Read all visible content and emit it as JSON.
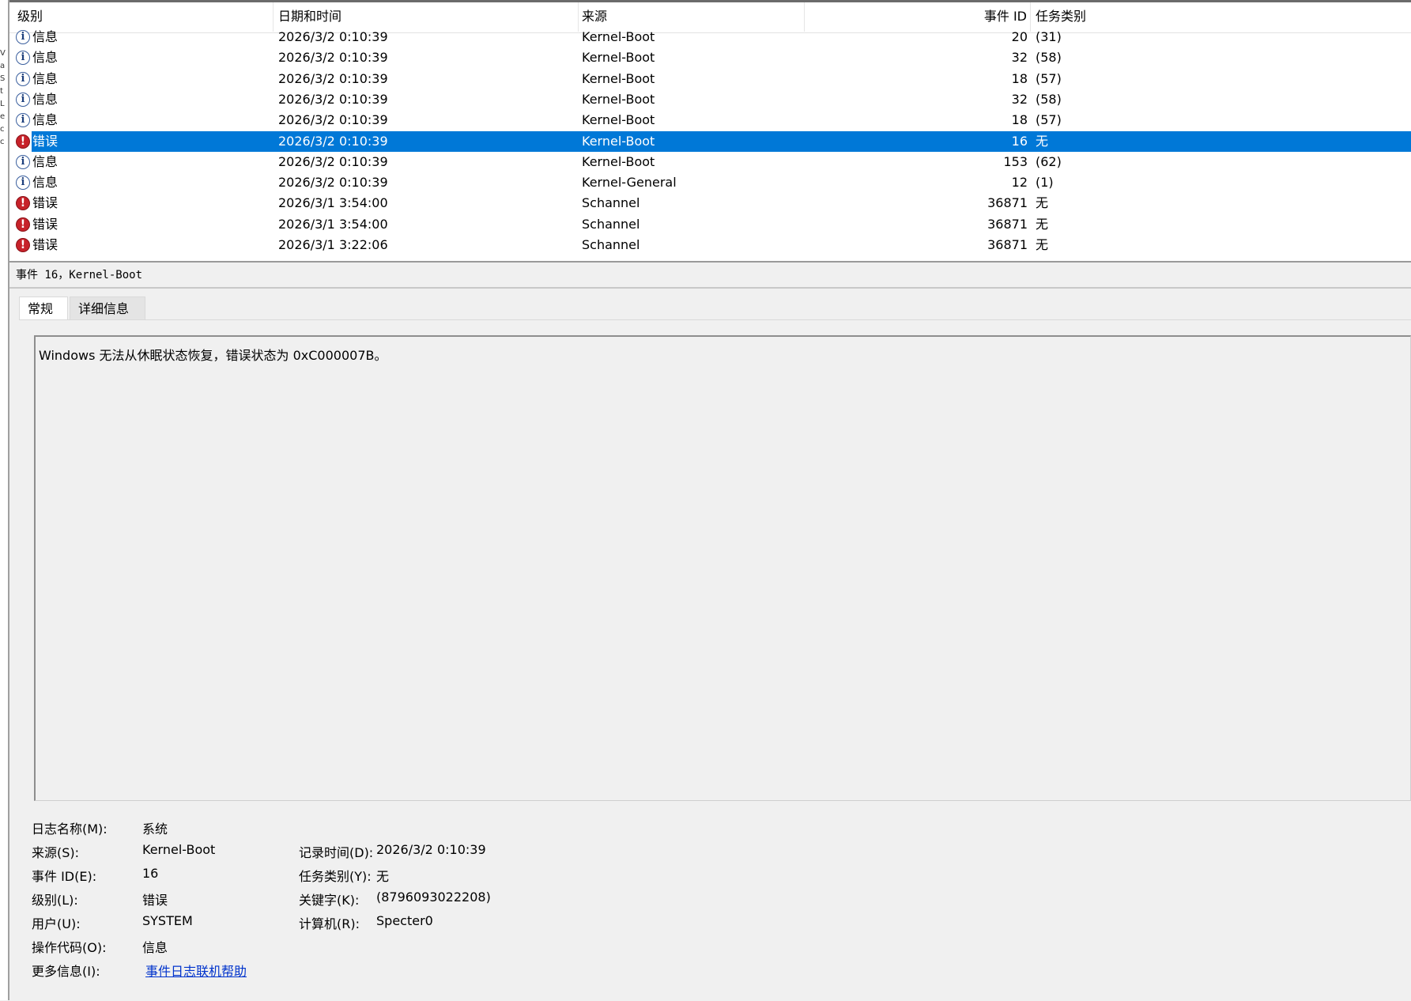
{
  "left_edge_glyphs": [
    "V",
    "a",
    "S",
    "t",
    "L",
    "e",
    "c",
    "c"
  ],
  "list": {
    "headers": {
      "level": "级别",
      "datetime": "日期和时间",
      "source": "来源",
      "event_id": "事件 ID",
      "task_category": "任务类别"
    },
    "rows": [
      {
        "level_icon": "info-icon",
        "level": "信息",
        "datetime": "2026/3/2 0:10:39",
        "source": "Kernel-Boot",
        "event_id": "20",
        "task": "(31)"
      },
      {
        "level_icon": "info-icon",
        "level": "信息",
        "datetime": "2026/3/2 0:10:39",
        "source": "Kernel-Boot",
        "event_id": "32",
        "task": "(58)"
      },
      {
        "level_icon": "info-icon",
        "level": "信息",
        "datetime": "2026/3/2 0:10:39",
        "source": "Kernel-Boot",
        "event_id": "18",
        "task": "(57)"
      },
      {
        "level_icon": "info-icon",
        "level": "信息",
        "datetime": "2026/3/2 0:10:39",
        "source": "Kernel-Boot",
        "event_id": "32",
        "task": "(58)"
      },
      {
        "level_icon": "info-icon",
        "level": "信息",
        "datetime": "2026/3/2 0:10:39",
        "source": "Kernel-Boot",
        "event_id": "18",
        "task": "(57)"
      },
      {
        "level_icon": "error-icon",
        "level": "错误",
        "datetime": "2026/3/2 0:10:39",
        "source": "Kernel-Boot",
        "event_id": "16",
        "task": "无",
        "selected": true
      },
      {
        "level_icon": "info-icon",
        "level": "信息",
        "datetime": "2026/3/2 0:10:39",
        "source": "Kernel-Boot",
        "event_id": "153",
        "task": "(62)"
      },
      {
        "level_icon": "info-icon",
        "level": "信息",
        "datetime": "2026/3/2 0:10:39",
        "source": "Kernel-General",
        "event_id": "12",
        "task": "(1)"
      },
      {
        "level_icon": "error-icon",
        "level": "错误",
        "datetime": "2026/3/1 3:54:00",
        "source": "Schannel",
        "event_id": "36871",
        "task": "无"
      },
      {
        "level_icon": "error-icon",
        "level": "错误",
        "datetime": "2026/3/1 3:54:00",
        "source": "Schannel",
        "event_id": "36871",
        "task": "无"
      },
      {
        "level_icon": "error-icon",
        "level": "错误",
        "datetime": "2026/3/1 3:22:06",
        "source": "Schannel",
        "event_id": "36871",
        "task": "无"
      }
    ]
  },
  "detail": {
    "title": "事件 16，Kernel-Boot",
    "tabs": {
      "general": "常规",
      "details": "详细信息"
    },
    "message": "Windows 无法从休眠状态恢复，错误状态为 0xC000007B。",
    "props": {
      "log_name_label": "日志名称(M):",
      "log_name": "系统",
      "source_label": "来源(S):",
      "source": "Kernel-Boot",
      "event_id_label": "事件 ID(E):",
      "event_id": "16",
      "level_label": "级别(L):",
      "level": "错误",
      "user_label": "用户(U):",
      "user": "SYSTEM",
      "opcode_label": "操作代码(O):",
      "opcode": "信息",
      "more_info_label": "更多信息(I):",
      "more_info_link": "事件日志联机帮助",
      "logged_label": "记录时间(D):",
      "logged": "2026/3/2 0:10:39",
      "task_label": "任务类别(Y):",
      "task": "无",
      "keywords_label": "关键字(K):",
      "keywords": "(8796093022208)",
      "computer_label": "计算机(R):",
      "computer": "Specter0"
    }
  },
  "colors": {
    "selection": "#0078d7",
    "error_icon": "#c7222a",
    "info_icon": "#3a5f9e",
    "link": "#0033cc"
  }
}
